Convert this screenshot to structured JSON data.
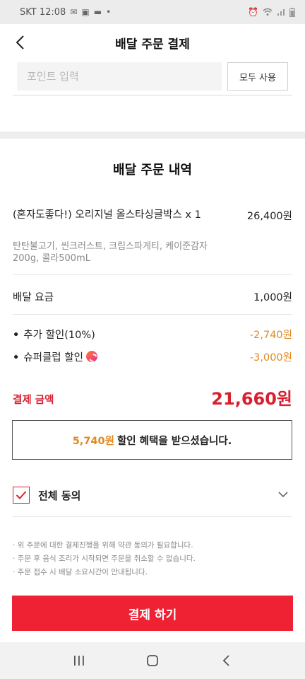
{
  "status_bar": {
    "carrier_time": "SKT 12:08",
    "battery_icon": "battery-icon",
    "wifi_icon": "wifi-icon"
  },
  "header": {
    "title": "배달 주문 결제",
    "back_icon": "chevron-left-icon"
  },
  "points": {
    "placeholder": "포인트 입력",
    "use_all_label": "모두 사용"
  },
  "order": {
    "section_title": "배달 주문 내역",
    "item": {
      "name": "(혼자도좋다!) 오리지널 올스타싱글박스 x 1",
      "price": "26,400원",
      "description": "탄탄불고기, 씬크러스트, 크림스파게티, 케이준감자200g, 콜라500mL"
    },
    "delivery_fee_label": "배달 요금",
    "delivery_fee_value": "1,000원",
    "extra_discount_label": "추가 할인(10%)",
    "extra_discount_value": "-2,740원",
    "superclub_label": "슈퍼클럽 할인",
    "superclub_value": "-3,000원",
    "payment_label": "결제 금액",
    "payment_value": "21,660원"
  },
  "benefit": {
    "amount": "5,740원",
    "text": "할인 혜택을 받으셨습니다."
  },
  "agreement": {
    "label": "전체 동의",
    "checked": true
  },
  "notices": [
    "· 위 주문에 대한 결제진행을 위해 약관 동의가 필요합니다.",
    "· 주문 후 음식 조리가 시작되면 주문을 취소할 수 없습니다.",
    "· 주문 접수 시 배달 소요시간이 안내됩니다."
  ],
  "pay_button_label": "결제 하기",
  "colors": {
    "accent_red": "#ee2233",
    "price_red": "#d8202f",
    "discount_orange": "#e1881e"
  }
}
